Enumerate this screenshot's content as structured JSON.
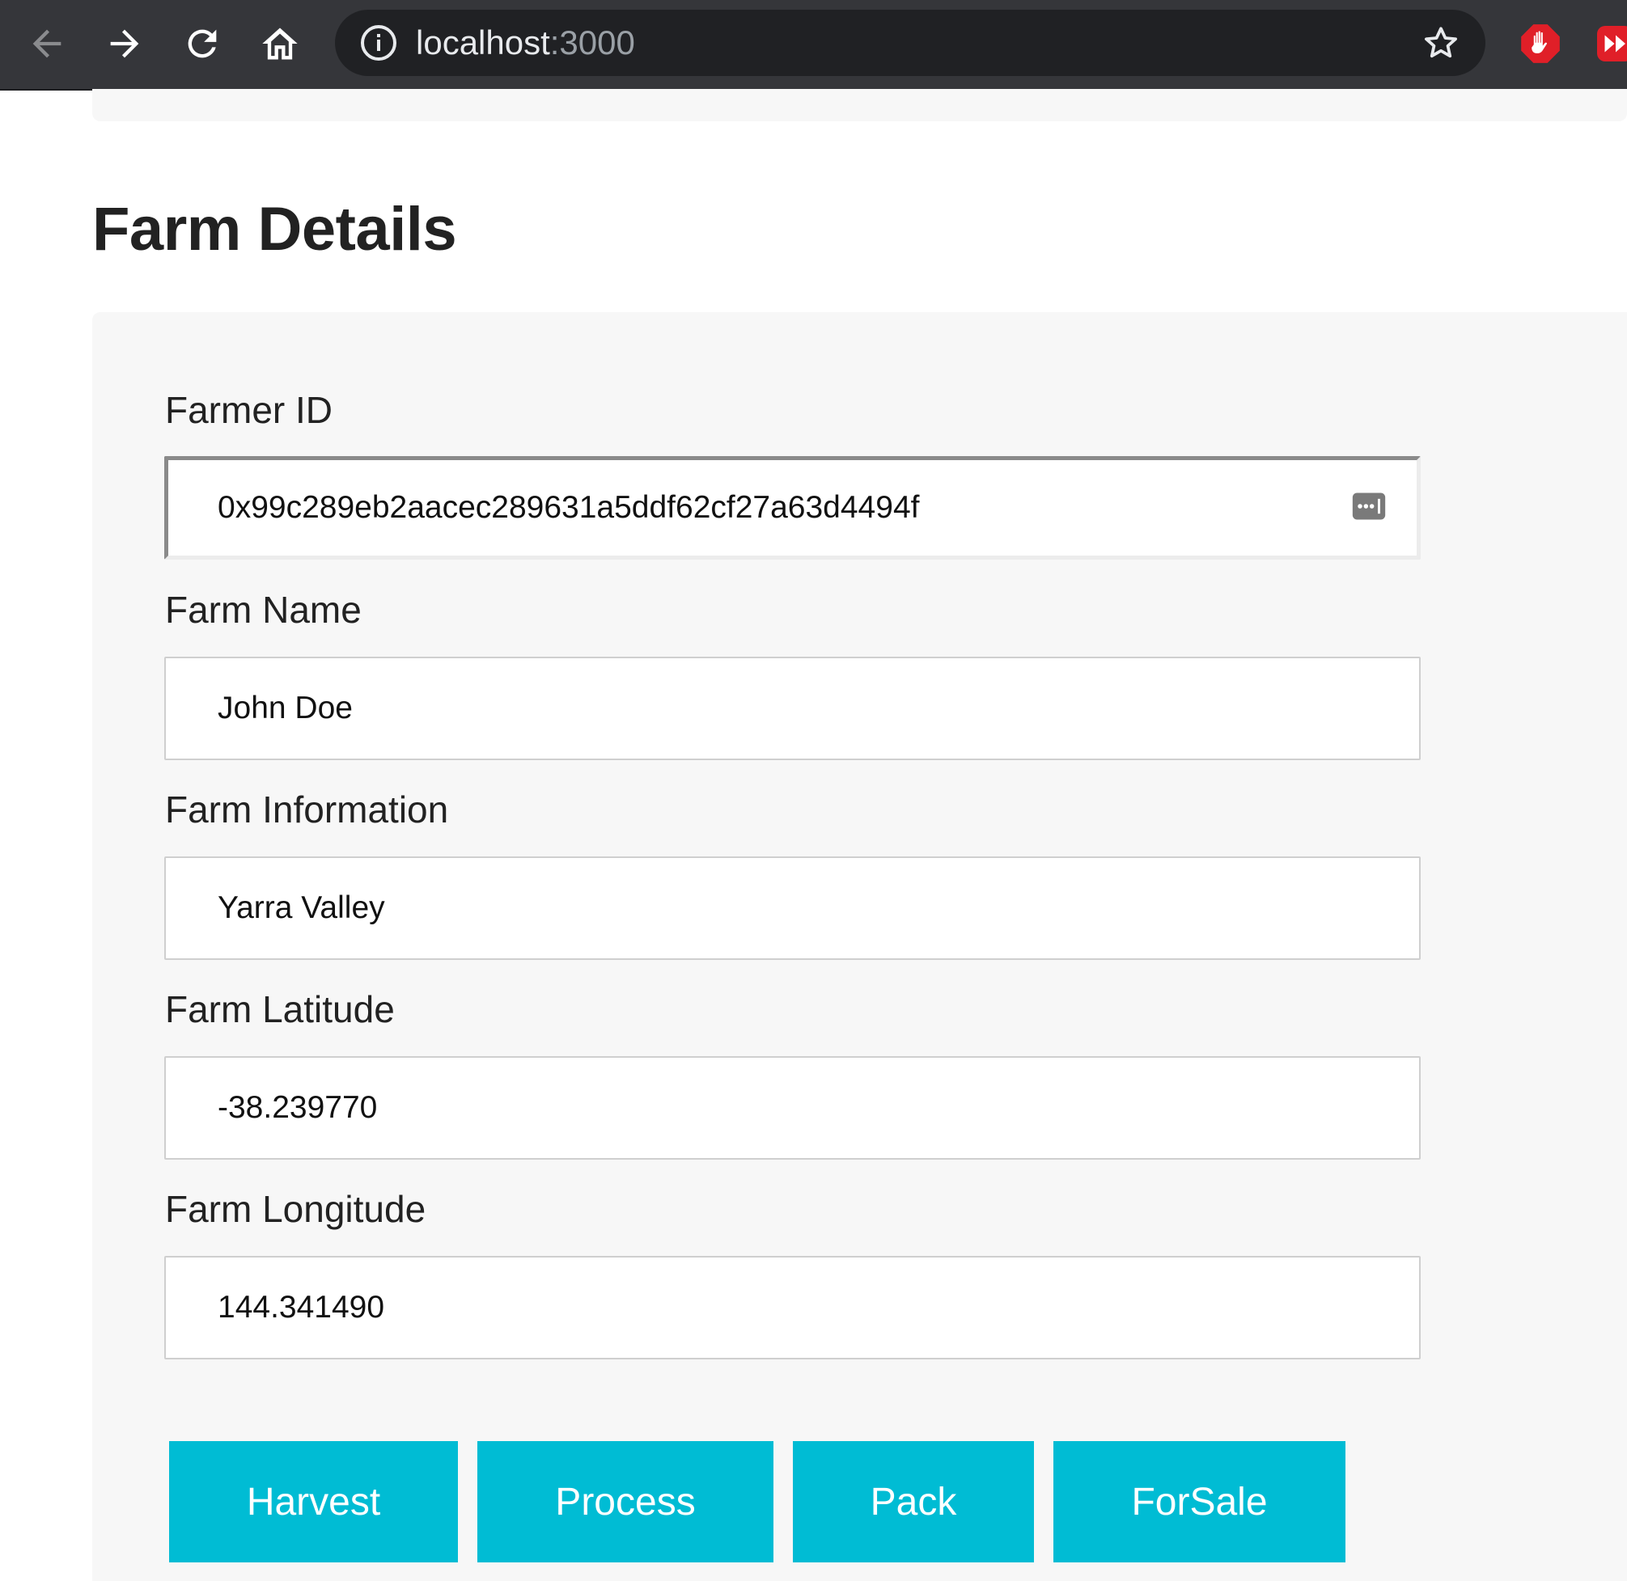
{
  "browser": {
    "url_host": "localhost",
    "url_port": ":3000"
  },
  "page": {
    "title": "Farm Details"
  },
  "form": {
    "fields": [
      {
        "label": "Farmer ID",
        "value": "0x99c289eb2aacec289631a5ddf62cf27a63d4494f"
      },
      {
        "label": "Farm Name",
        "value": "John Doe"
      },
      {
        "label": "Farm Information",
        "value": "Yarra Valley"
      },
      {
        "label": "Farm Latitude",
        "value": "-38.239770"
      },
      {
        "label": "Farm Longitude",
        "value": "144.341490"
      }
    ]
  },
  "actions": {
    "harvest": "Harvest",
    "process": "Process",
    "pack": "Pack",
    "forsale": "ForSale"
  },
  "colors": {
    "accent": "#00bcd4",
    "card_background": "#f7f7f7",
    "toolbar": "#35363a"
  },
  "icons": {
    "back": "arrow-left-icon",
    "forward": "arrow-right-icon",
    "reload": "reload-icon",
    "home": "home-icon",
    "info": "info-icon",
    "star": "star-icon",
    "autofill": "password-manager-icon",
    "extension_stop": "stop-hand-icon",
    "extension_media": "fast-forward-icon"
  }
}
